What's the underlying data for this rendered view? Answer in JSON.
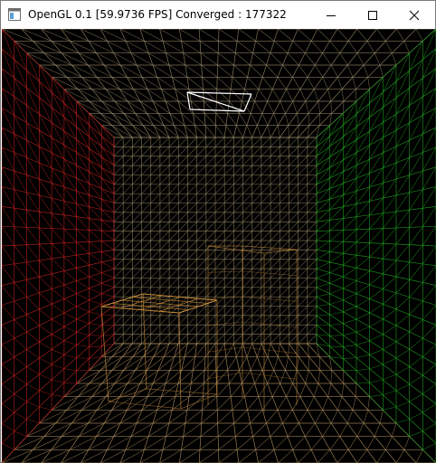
{
  "window": {
    "title": "OpenGL 0.1 [59.9736 FPS] Converged : 177322",
    "controls": {
      "minimize": "minimize-icon",
      "maximize": "maximize-icon",
      "close": "close-icon"
    }
  },
  "scene": {
    "background": "#000000",
    "left_wall_color": "#c02020",
    "right_wall_color": "#20a020",
    "floor_color": "#b08f60",
    "ceiling_color": "#9a8a6a",
    "back_wall_color": "#8a7a5a",
    "box_color": "#c58a3a",
    "light_color": "#ffffff"
  }
}
